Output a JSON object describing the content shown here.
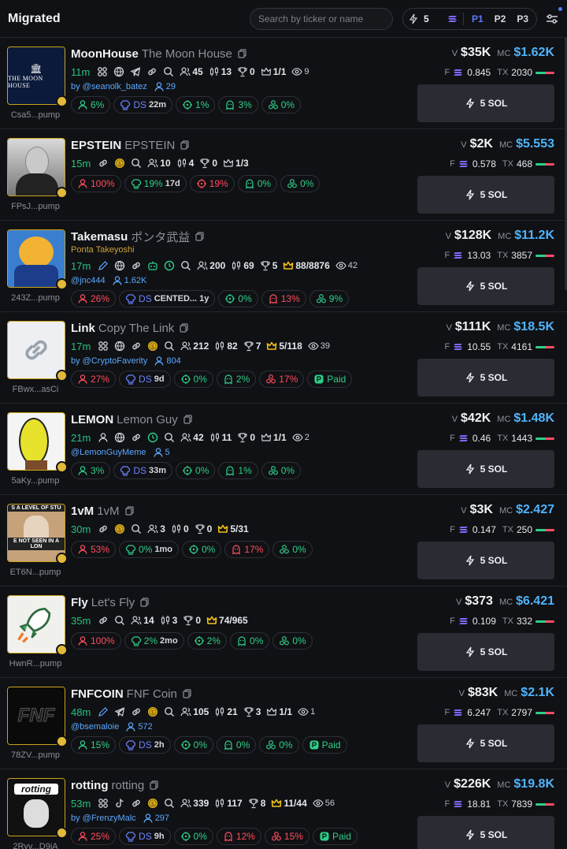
{
  "header": {
    "title": "Migrated",
    "search_placeholder": "Search by ticker or name",
    "preset_amount": "5",
    "presets": [
      "P1",
      "P2",
      "P3"
    ]
  },
  "colors": {
    "green": "#2ecf8a",
    "red": "#ff4d5e",
    "blue": "#4fb4ff",
    "gold": "#c9a419"
  },
  "tokens": [
    {
      "symbol": "MoonHouse",
      "name": "The Moon House",
      "address": "Csa5...pump",
      "age": "11m",
      "sub": "",
      "twitter": "by @seanolk_batez",
      "followers": "29",
      "icons": [
        "community-icon",
        "globe-icon",
        "telegram-icon",
        "link-icon",
        "search-icon"
      ],
      "stats": [
        {
          "i": "holders-icon",
          "v": "45"
        },
        {
          "i": "candles-icon",
          "v": "13"
        },
        {
          "i": "trophy-icon",
          "v": "0"
        },
        {
          "i": "crown-icon",
          "v": "1/1"
        },
        {
          "i": "eye-icon",
          "v": "9",
          "sm": true
        }
      ],
      "pills": [
        {
          "i": "user-icon",
          "v": "6%",
          "c": "g"
        },
        {
          "i": "chef-icon",
          "v": "DS",
          "x": "22m",
          "c": "b"
        },
        {
          "i": "target-icon",
          "v": "1%",
          "c": "g"
        },
        {
          "i": "ghost-icon",
          "v": "3%",
          "c": "g"
        },
        {
          "i": "bundle-icon",
          "v": "0%",
          "c": "g"
        }
      ],
      "v": "$35K",
      "mc": "$1.62K",
      "f": "0.845",
      "tx": "2030",
      "buy": "5 SOL"
    },
    {
      "symbol": "EPSTEIN",
      "name": "EPSTEIN",
      "address": "FPsJ...pump",
      "age": "15m",
      "sub": "",
      "twitter": "",
      "followers": "",
      "icons": [
        "link-icon",
        "coin-icon",
        "search-icon"
      ],
      "stats": [
        {
          "i": "holders-icon",
          "v": "10"
        },
        {
          "i": "candles-icon",
          "v": "4"
        },
        {
          "i": "trophy-icon",
          "v": "0"
        },
        {
          "i": "crown-icon",
          "v": "1/3"
        }
      ],
      "pills": [
        {
          "i": "user-icon",
          "v": "100%",
          "c": "r"
        },
        {
          "i": "chef-icon",
          "v": "19%",
          "x": "17d",
          "c": "g"
        },
        {
          "i": "target-icon",
          "v": "19%",
          "c": "r"
        },
        {
          "i": "ghost-icon",
          "v": "0%",
          "c": "g"
        },
        {
          "i": "bundle-icon",
          "v": "0%",
          "c": "g"
        }
      ],
      "v": "$2K",
      "mc": "$5.553",
      "f": "0.578",
      "tx": "468",
      "buy": "5 SOL"
    },
    {
      "symbol": "Takemasu",
      "name": "ポンタ武益",
      "address": "243Z...pump",
      "age": "17m",
      "sub": "Ponta Takeyoshi",
      "twitter": "@jnc444",
      "followers": "1.62K",
      "icons": [
        "pen-icon",
        "globe-icon",
        "link-icon",
        "robot-icon",
        "clock-icon",
        "search-icon"
      ],
      "stats": [
        {
          "i": "holders-icon",
          "v": "200"
        },
        {
          "i": "candles-icon",
          "v": "69"
        },
        {
          "i": "trophy-icon",
          "v": "5"
        },
        {
          "i": "crown-gold-icon",
          "v": "88/8876"
        },
        {
          "i": "eye-icon",
          "v": "42",
          "sm": true
        }
      ],
      "pills": [
        {
          "i": "user-icon",
          "v": "26%",
          "c": "r"
        },
        {
          "i": "chef-icon",
          "v": "DS",
          "x": "CENTED... 1y",
          "c": "b"
        },
        {
          "i": "target-icon",
          "v": "0%",
          "c": "g"
        },
        {
          "i": "ghost-icon",
          "v": "13%",
          "c": "r"
        },
        {
          "i": "bundle-icon",
          "v": "9%",
          "c": "g"
        }
      ],
      "v": "$128K",
      "mc": "$11.2K",
      "f": "13.03",
      "tx": "3857",
      "buy": "5 SOL"
    },
    {
      "symbol": "Link",
      "name": "Copy The Link",
      "address": "FBwx...asCi",
      "age": "17m",
      "sub": "",
      "twitter": "by @CryptoFaverity",
      "followers": "804",
      "icons": [
        "community-icon",
        "globe-icon",
        "link-icon",
        "coin-icon",
        "search-icon"
      ],
      "stats": [
        {
          "i": "holders-icon",
          "v": "212"
        },
        {
          "i": "candles-icon",
          "v": "82"
        },
        {
          "i": "trophy-icon",
          "v": "7"
        },
        {
          "i": "crown-gold-icon",
          "v": "5/118"
        },
        {
          "i": "eye-icon",
          "v": "39",
          "sm": true
        }
      ],
      "pills": [
        {
          "i": "user-icon",
          "v": "27%",
          "c": "r"
        },
        {
          "i": "chef-icon",
          "v": "DS",
          "x": "9d",
          "c": "b"
        },
        {
          "i": "target-icon",
          "v": "0%",
          "c": "g"
        },
        {
          "i": "ghost-icon",
          "v": "2%",
          "c": "g"
        },
        {
          "i": "bundle-icon",
          "v": "17%",
          "c": "r"
        },
        {
          "i": "paid-icon",
          "v": "Paid",
          "c": "g"
        }
      ],
      "v": "$111K",
      "mc": "$18.5K",
      "f": "10.55",
      "tx": "4161",
      "buy": "5 SOL"
    },
    {
      "symbol": "LEMON",
      "name": "Lemon Guy",
      "address": "5aKy...pump",
      "age": "21m",
      "sub": "",
      "twitter": "@LemonGuyMeme",
      "followers": "5",
      "icons": [
        "user-icon",
        "globe-icon",
        "link-icon",
        "clock-icon",
        "search-icon"
      ],
      "stats": [
        {
          "i": "holders-icon",
          "v": "42"
        },
        {
          "i": "candles-icon",
          "v": "11"
        },
        {
          "i": "trophy-icon",
          "v": "0"
        },
        {
          "i": "crown-icon",
          "v": "1/1"
        },
        {
          "i": "eye-icon",
          "v": "2",
          "sm": true
        }
      ],
      "pills": [
        {
          "i": "user-icon",
          "v": "3%",
          "c": "g"
        },
        {
          "i": "chef-icon",
          "v": "DS",
          "x": "33m",
          "c": "b"
        },
        {
          "i": "target-icon",
          "v": "0%",
          "c": "g"
        },
        {
          "i": "ghost-icon",
          "v": "1%",
          "c": "g"
        },
        {
          "i": "bundle-icon",
          "v": "0%",
          "c": "g"
        }
      ],
      "v": "$42K",
      "mc": "$1.48K",
      "f": "0.46",
      "tx": "1443",
      "buy": "5 SOL"
    },
    {
      "symbol": "1vM",
      "name": "1vM",
      "address": "ET6N...pump",
      "age": "30m",
      "sub": "",
      "twitter": "",
      "followers": "",
      "icons": [
        "link-icon",
        "coin-icon",
        "search-icon"
      ],
      "stats": [
        {
          "i": "holders-icon",
          "v": "3"
        },
        {
          "i": "candles-icon",
          "v": "0"
        },
        {
          "i": "trophy-icon",
          "v": "0"
        },
        {
          "i": "crown-gold-icon",
          "v": "5/31"
        }
      ],
      "pills": [
        {
          "i": "user-icon",
          "v": "53%",
          "c": "r"
        },
        {
          "i": "chef-icon",
          "v": "0%",
          "x": "1mo",
          "c": "g"
        },
        {
          "i": "target-icon",
          "v": "0%",
          "c": "g"
        },
        {
          "i": "ghost-icon",
          "v": "17%",
          "c": "r"
        },
        {
          "i": "bundle-icon",
          "v": "0%",
          "c": "g"
        }
      ],
      "v": "$3K",
      "mc": "$2.427",
      "f": "0.147",
      "tx": "250",
      "buy": "5 SOL"
    },
    {
      "symbol": "Fly",
      "name": "Let's Fly",
      "address": "HwnR...pump",
      "age": "35m",
      "sub": "",
      "twitter": "",
      "followers": "",
      "icons": [
        "link-icon",
        "search-icon"
      ],
      "stats": [
        {
          "i": "holders-icon",
          "v": "14"
        },
        {
          "i": "candles-icon",
          "v": "3"
        },
        {
          "i": "trophy-icon",
          "v": "0"
        },
        {
          "i": "crown-gold-icon",
          "v": "74/965"
        }
      ],
      "pills": [
        {
          "i": "user-icon",
          "v": "100%",
          "c": "r"
        },
        {
          "i": "chef-icon",
          "v": "2%",
          "x": "2mo",
          "c": "g"
        },
        {
          "i": "target-icon",
          "v": "2%",
          "c": "g"
        },
        {
          "i": "ghost-icon",
          "v": "0%",
          "c": "g"
        },
        {
          "i": "bundle-icon",
          "v": "0%",
          "c": "g"
        }
      ],
      "v": "$373",
      "mc": "$6.421",
      "f": "0.109",
      "tx": "332",
      "buy": "5 SOL"
    },
    {
      "symbol": "FNFCOIN",
      "name": "FNF Coin",
      "address": "78ZV...pump",
      "age": "48m",
      "sub": "",
      "twitter": "@bsemaloie",
      "followers": "572",
      "icons": [
        "pen-icon",
        "telegram-icon",
        "link-icon",
        "coin-icon",
        "search-icon"
      ],
      "stats": [
        {
          "i": "holders-icon",
          "v": "105"
        },
        {
          "i": "candles-icon",
          "v": "21"
        },
        {
          "i": "trophy-icon",
          "v": "3"
        },
        {
          "i": "crown-icon",
          "v": "1/1"
        },
        {
          "i": "eye-icon",
          "v": "1",
          "sm": true
        }
      ],
      "pills": [
        {
          "i": "user-icon",
          "v": "15%",
          "c": "g"
        },
        {
          "i": "chef-icon",
          "v": "DS",
          "x": "2h",
          "c": "b"
        },
        {
          "i": "target-icon",
          "v": "0%",
          "c": "g"
        },
        {
          "i": "ghost-icon",
          "v": "0%",
          "c": "g"
        },
        {
          "i": "bundle-icon",
          "v": "0%",
          "c": "g"
        },
        {
          "i": "paid-icon",
          "v": "Paid",
          "c": "g"
        }
      ],
      "v": "$83K",
      "mc": "$2.1K",
      "f": "6.247",
      "tx": "2797",
      "buy": "5 SOL"
    },
    {
      "symbol": "rotting",
      "name": "rotting",
      "address": "2Ryv...D9iA",
      "age": "53m",
      "sub": "",
      "twitter": "by @FrenzyMalc",
      "followers": "297",
      "icons": [
        "community-icon",
        "tiktok-icon",
        "link-icon",
        "coin-icon",
        "search-icon"
      ],
      "stats": [
        {
          "i": "holders-icon",
          "v": "339"
        },
        {
          "i": "candles-icon",
          "v": "117"
        },
        {
          "i": "trophy-icon",
          "v": "8"
        },
        {
          "i": "crown-gold-icon",
          "v": "11/44"
        },
        {
          "i": "eye-icon",
          "v": "56",
          "sm": true
        }
      ],
      "pills": [
        {
          "i": "user-icon",
          "v": "25%",
          "c": "r"
        },
        {
          "i": "chef-icon",
          "v": "DS",
          "x": "9h",
          "c": "b"
        },
        {
          "i": "target-icon",
          "v": "0%",
          "c": "g"
        },
        {
          "i": "ghost-icon",
          "v": "12%",
          "c": "r"
        },
        {
          "i": "bundle-icon",
          "v": "15%",
          "c": "r"
        },
        {
          "i": "paid-icon",
          "v": "Paid",
          "c": "g"
        }
      ],
      "v": "$226K",
      "mc": "$19.8K",
      "f": "18.81",
      "tx": "7839",
      "buy": "5 SOL"
    }
  ]
}
